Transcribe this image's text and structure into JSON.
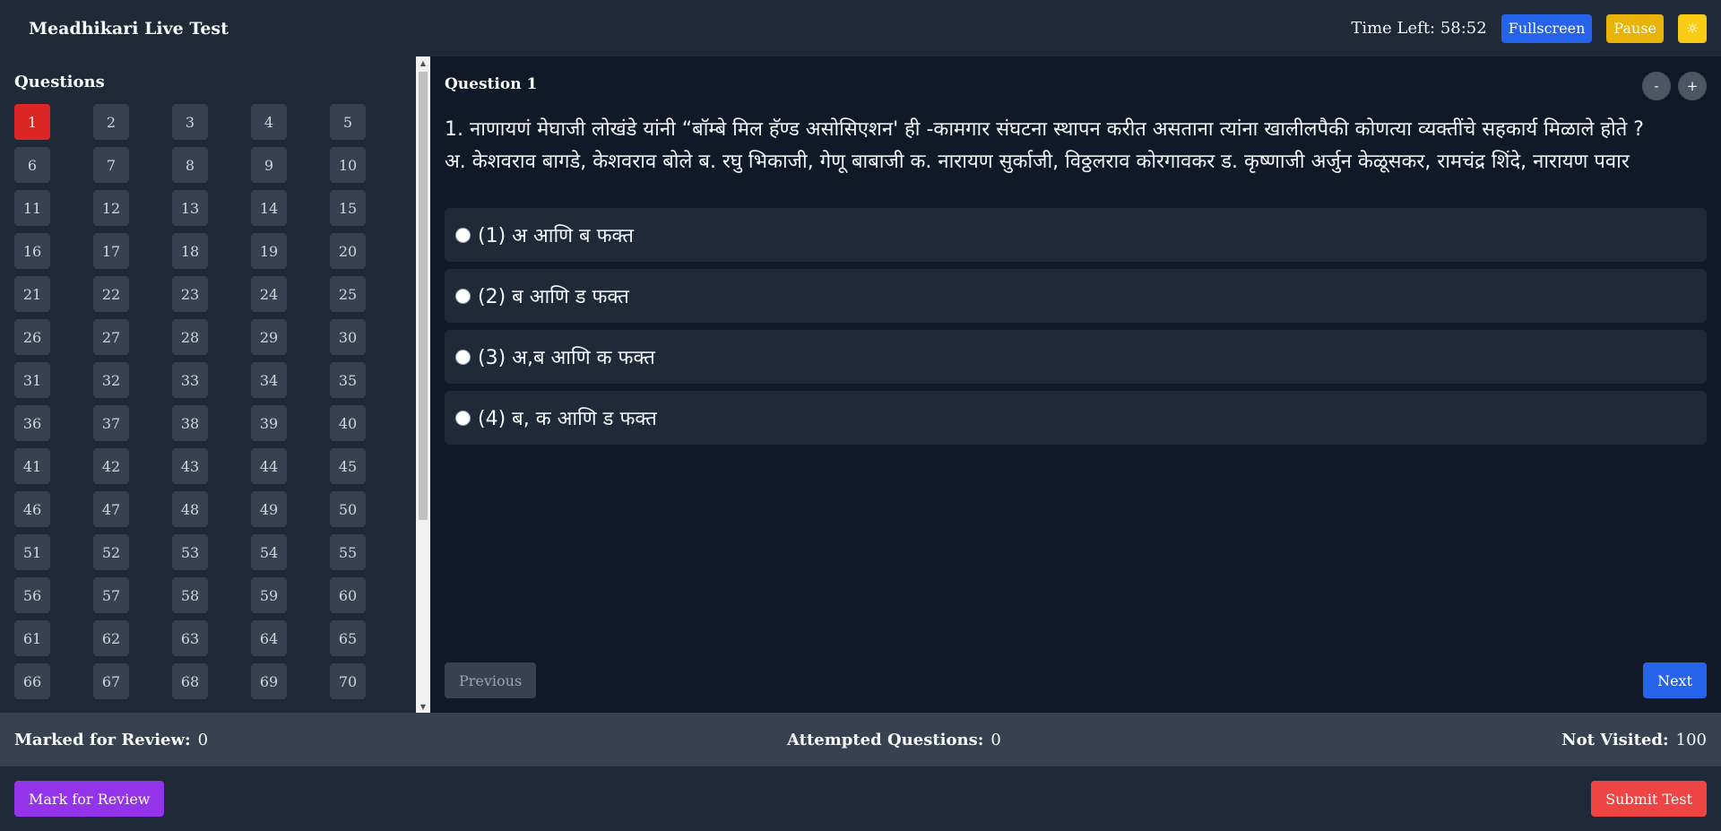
{
  "header": {
    "title": "Meadhikari Live Test",
    "timer": "Time Left: 58:52",
    "fullscreen_label": "Fullscreen",
    "pause_label": "Pause",
    "theme_icon": "sun-icon",
    "theme_glyph": "☼"
  },
  "sidebar": {
    "title": "Questions",
    "active": 1,
    "numbers": [
      "1",
      "2",
      "3",
      "4",
      "5",
      "6",
      "7",
      "8",
      "9",
      "10",
      "11",
      "12",
      "13",
      "14",
      "15",
      "16",
      "17",
      "18",
      "19",
      "20",
      "21",
      "22",
      "23",
      "24",
      "25",
      "26",
      "27",
      "28",
      "29",
      "30",
      "31",
      "32",
      "33",
      "34",
      "35",
      "36",
      "37",
      "38",
      "39",
      "40",
      "41",
      "42",
      "43",
      "44",
      "45",
      "46",
      "47",
      "48",
      "49",
      "50",
      "51",
      "52",
      "53",
      "54",
      "55",
      "56",
      "57",
      "58",
      "59",
      "60",
      "61",
      "62",
      "63",
      "64",
      "65",
      "66",
      "67",
      "68",
      "69",
      "70"
    ]
  },
  "question": {
    "title": "Question 1",
    "zoom_out": "-",
    "zoom_in": "+",
    "text_line1": "1. नाणायणं मेघाजी लोखंडे यांनी “बॉम्बे मिल हॅण्ड असोसिएशन' ही -कामगार संघटना स्थापन करीत असताना त्यांना खालीलपैकी कोणत्या व्यक्तींचे सहकार्य मिळाले होते ?",
    "text_line2": "अ. केशवराव बागडे, केशवराव बोले ब. रघु भिकाजी, गेणू बाबाजी क. नारायण सुर्काजी, विठ्ठलराव कोरगावकर ड. कृष्णाजी अर्जुन केळूसकर, रामचंद्र शिंदे, नारायण पवार",
    "options": [
      "(1) अ आणि ब फक्त",
      "(2) ब आणि ड फक्त",
      "(3) अ,ब आणि क फक्त",
      "(4) ब, क आणि ड फक्त"
    ],
    "previous_label": "Previous",
    "next_label": "Next"
  },
  "status": {
    "marked_label": "Marked for Review:",
    "marked_value": "0",
    "attempted_label": "Attempted Questions:",
    "attempted_value": "0",
    "notvisited_label": "Not Visited:",
    "notvisited_value": "100"
  },
  "footer": {
    "review_label": "Mark for Review",
    "submit_label": "Submit Test"
  },
  "colors": {
    "active_question": "#dc2626",
    "primary": "#2563eb",
    "review": "#9333ea",
    "submit": "#ef4444",
    "pause": "#eab308"
  }
}
